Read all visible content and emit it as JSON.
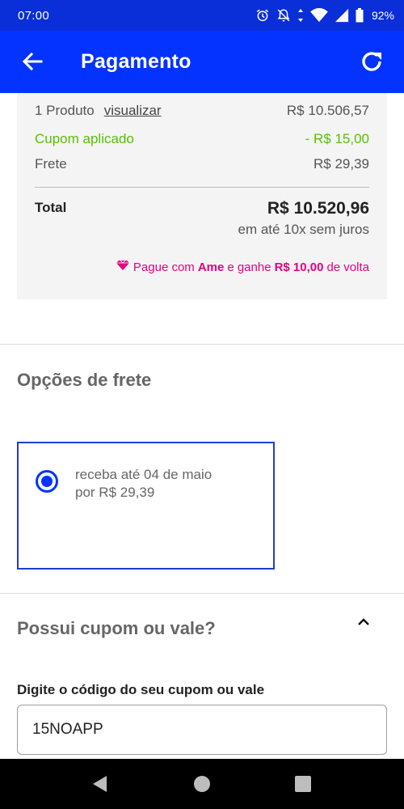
{
  "status_bar": {
    "time": "07:00",
    "battery": "92%",
    "icons": [
      "alarm-icon",
      "notifications-off-icon",
      "wifi-icon",
      "signal-icon",
      "battery-icon"
    ]
  },
  "app_bar": {
    "title": "Pagamento",
    "back_icon": "arrow-left-icon",
    "refresh_icon": "refresh-icon",
    "color": "#0433ff"
  },
  "summary": {
    "product_label": "1 Produto",
    "view_link": "visualizar",
    "product_value": "R$ 10.506,57",
    "coupon_label": "Cupom aplicado",
    "coupon_value": "- R$ 15,00",
    "shipping_label": "Frete",
    "shipping_value": "R$ 29,39",
    "total_label": "Total",
    "total_value": "R$ 10.520,96",
    "installments": "em até 10x sem juros",
    "ame": {
      "prefix": "Pague com",
      "brand": "Ame",
      "middle": "e ganhe",
      "amount": "R$ 10,00",
      "suffix": "de volta",
      "color": "#e5007e"
    }
  },
  "shipping_options": {
    "title": "Opções de frete",
    "options": [
      {
        "line1": "receba até 04 de maio",
        "line2": "por R$ 29,39",
        "selected": true
      }
    ]
  },
  "coupon_section": {
    "title": "Possui cupom ou vale?",
    "input_label": "Digite o código do seu cupom ou vale",
    "input_value": "15NOAPP",
    "expanded": true
  },
  "colors": {
    "coupon_green": "#55c100",
    "accent_blue": "#0433ff"
  }
}
